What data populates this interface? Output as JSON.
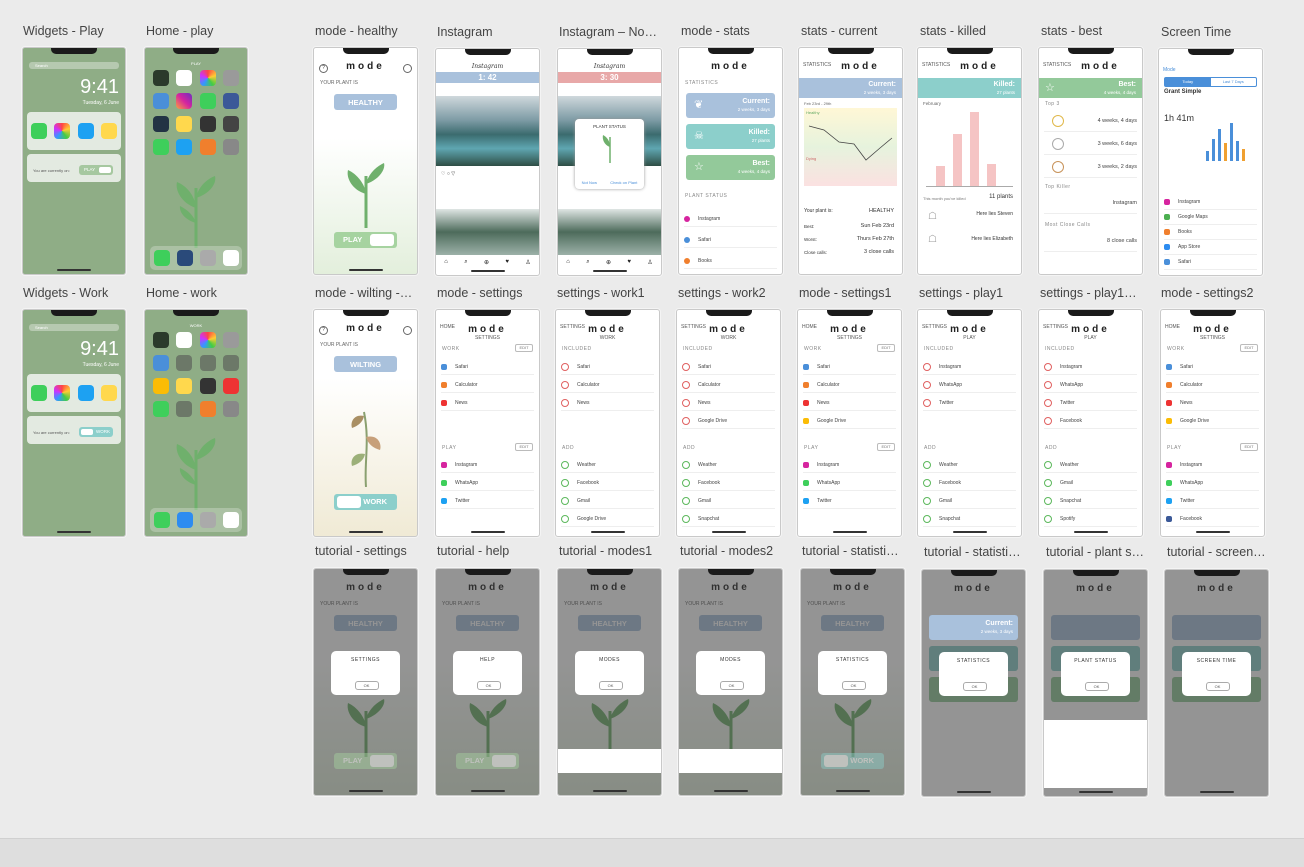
{
  "frames": {
    "widgets_play": {
      "title": "Widgets - Play",
      "time": "9:41",
      "date": "Tuesday, 6 June",
      "search": "Search",
      "widget_text": "You are currently on:",
      "mode": "PLAY"
    },
    "home_play": {
      "title": "Home - play",
      "label": "PLAY"
    },
    "mode_healthy": {
      "title": "mode - healthy",
      "logo": "mode",
      "your_plant": "YOUR PLANT IS",
      "status": "HEALTHY",
      "mode": "PLAY"
    },
    "instagram": {
      "title": "Instagram",
      "brand": "Instagram",
      "timer": "1: 42"
    },
    "instagram_noti": {
      "title": "Instagram – Noti…",
      "brand": "Instagram",
      "timer": "3: 30",
      "popup_title": "PLANT STATUS",
      "not_now": "Not Now",
      "check": "Check on Plant"
    },
    "mode_stats": {
      "title": "mode - stats",
      "logo": "mode",
      "statistics": "STATISTICS",
      "current_t": "Current:",
      "current_s": "2 weeks, 3 days",
      "killed_t": "Killed:",
      "killed_s": "27 plants",
      "best_t": "Best:",
      "best_s": "4 weeks, 4 days",
      "plant_status": "PLANT STATUS"
    },
    "stats_current": {
      "title": "stats - current",
      "logo": "mode",
      "back": "STATISTICS",
      "head_t": "Current:",
      "head_s": "2 weeks, 3 days",
      "range": "Feb 23rd - 29th",
      "healthy": "Healthy",
      "dying": "Dying",
      "plant_is": "Your plant is:",
      "plant_val": "HEALTHY",
      "best": "Best:",
      "best_v": "Sun Feb 23rd",
      "worst": "Worst:",
      "worst_v": "Thurs Feb 27th",
      "close": "Close calls:",
      "close_v": "3 close calls"
    },
    "stats_killed": {
      "title": "stats - killed",
      "logo": "mode",
      "back": "STATISTICS",
      "head_t": "Killed:",
      "head_s": "27 plants",
      "month": "February",
      "note": "This month you've killed",
      "count": "11 plants",
      "rip1": "Here lies Steven",
      "rip2": "Here lies Elizabeth"
    },
    "stats_best": {
      "title": "stats - best",
      "logo": "mode",
      "back": "STATISTICS",
      "head_t": "Best:",
      "head_s": "4 weeks, 4 days",
      "top3": "Top 3",
      "r1": "4 weeks, 4 days",
      "r2": "3 weeks, 6 days",
      "r3": "3 weeks, 2 days",
      "top_killer": "Top Killer",
      "killer": "Instagram",
      "most_close": "Most Close Calls",
      "close": "8 close calls"
    },
    "screen_time": {
      "title": "Screen Time",
      "back": "Mode",
      "tab1": "Today",
      "tab2": "Last 7 Days",
      "device": "Grant Simple",
      "total": "1h 41m",
      "apps": [
        "Instagram",
        "Google Maps",
        "Books",
        "App Store",
        "Safari"
      ]
    },
    "widgets_work": {
      "title": "Widgets - Work",
      "time": "9:41",
      "date": "Tuesday, 6 June",
      "search": "Search",
      "widget_text": "You are currently on:",
      "mode": "WORK"
    },
    "home_work": {
      "title": "Home - work",
      "label": "WORK"
    },
    "mode_wilting": {
      "title": "mode - wilting -…",
      "logo": "mode",
      "your_plant": "YOUR PLANT IS",
      "status": "WILTING",
      "mode": "WORK"
    },
    "mode_settings": {
      "title": "mode - settings",
      "logo": "mode",
      "sub": "SETTINGS",
      "back": "HOME",
      "work": "WORK",
      "play": "PLAY",
      "edit": "EDIT",
      "work_apps": [
        "Safari",
        "Calculator",
        "News"
      ],
      "play_apps": [
        "Instagram",
        "WhatsApp",
        "Twitter"
      ]
    },
    "settings_work1": {
      "title": "settings - work1",
      "logo": "mode",
      "sub": "WORK",
      "back": "SETTINGS",
      "included": "INCLUDED",
      "add": "ADD",
      "inc_apps": [
        "Safari",
        "Calculator",
        "News"
      ],
      "add_apps": [
        "Weather",
        "Facebook",
        "Gmail",
        "Google Drive"
      ]
    },
    "settings_work2": {
      "title": "settings - work2",
      "logo": "mode",
      "sub": "WORK",
      "back": "SETTINGS",
      "included": "INCLUDED",
      "add": "ADD",
      "inc_apps": [
        "Safari",
        "Calculator",
        "News",
        "Google Drive"
      ],
      "add_apps": [
        "Weather",
        "Facebook",
        "Gmail",
        "Snapchat"
      ]
    },
    "mode_settings1": {
      "title": "mode - settings1",
      "logo": "mode",
      "sub": "SETTINGS",
      "back": "HOME",
      "work": "WORK",
      "play": "PLAY",
      "edit": "EDIT",
      "work_apps": [
        "Safari",
        "Calculator",
        "News",
        "Google Drive"
      ],
      "play_apps": [
        "Instagram",
        "WhatsApp",
        "Twitter"
      ]
    },
    "settings_play1": {
      "title": "settings - play1",
      "logo": "mode",
      "sub": "PLAY",
      "back": "SETTINGS",
      "included": "INCLUDED",
      "add": "ADD",
      "inc_apps": [
        "Instagram",
        "WhatsApp",
        "Twitter"
      ],
      "add_apps": [
        "Weather",
        "Facebook",
        "Gmail",
        "Snapchat"
      ]
    },
    "settings_play1b": {
      "title": "settings - play1 –…",
      "logo": "mode",
      "sub": "PLAY",
      "back": "SETTINGS",
      "included": "INCLUDED",
      "add": "ADD",
      "inc_apps": [
        "Instagram",
        "WhatsApp",
        "Twitter",
        "Facebook"
      ],
      "add_apps": [
        "Weather",
        "Gmail",
        "Snapchat",
        "Spotify"
      ]
    },
    "mode_settings2": {
      "title": "mode - settings2",
      "logo": "mode",
      "sub": "SETTINGS",
      "back": "HOME",
      "work": "WORK",
      "play": "PLAY",
      "edit": "EDIT",
      "work_apps": [
        "Safari",
        "Calculator",
        "News",
        "Google Drive"
      ],
      "play_apps": [
        "Instagram",
        "WhatsApp",
        "Twitter",
        "Facebook"
      ]
    },
    "tut_settings": {
      "title": "tutorial - settings",
      "popup": "SETTINGS",
      "ok": "OK"
    },
    "tut_help": {
      "title": "tutorial - help",
      "popup": "HELP",
      "ok": "OK"
    },
    "tut_modes1": {
      "title": "tutorial - modes1",
      "popup": "MODES",
      "mode": "PLAY"
    },
    "tut_modes2": {
      "title": "tutorial - modes2",
      "popup": "MODES",
      "mode": "WORK"
    },
    "tut_stats": {
      "title": "tutorial - statistic…",
      "popup": "STATISTICS"
    },
    "tut_stats2": {
      "title": "tutorial - statistic…",
      "popup": "STATISTICS",
      "ok": "OK",
      "current_t": "Current:",
      "current_s": "2 weeks, 3 days"
    },
    "tut_plant": {
      "title": "tutorial - plant st…",
      "popup": "PLANT STATUS",
      "ok": "OK"
    },
    "tut_screen": {
      "title": "tutorial - screen t…",
      "popup": "SCREEN TIME",
      "ok": "OK"
    }
  },
  "shared": {
    "logo": "mode",
    "your_plant": "YOUR PLANT IS",
    "healthy": "HEALTHY",
    "play": "PLAY",
    "work": "WORK",
    "ok": "OK",
    "time": "9:41"
  },
  "colors": {
    "sage": "#8fad86",
    "blue": "#a9c1dc",
    "teal": "#8ccfcb",
    "green_card": "#93c99a",
    "pink": "#f5c4c4",
    "board": "#ebebeb"
  }
}
